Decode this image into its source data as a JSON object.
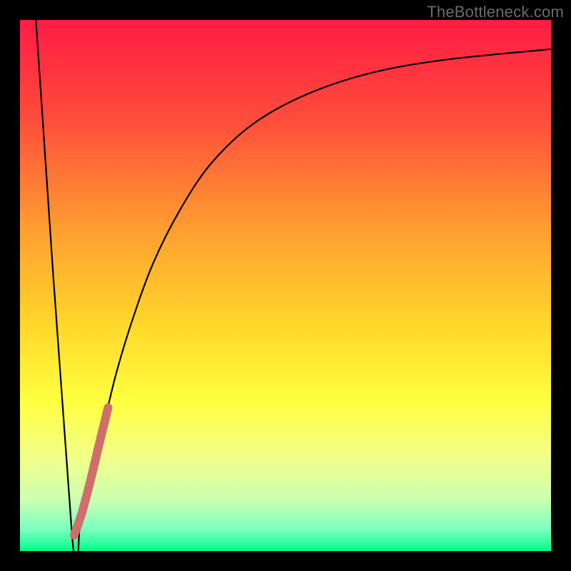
{
  "watermark": "TheBottleneck.com",
  "chart_data": {
    "type": "line",
    "title": "",
    "xlabel": "",
    "ylabel": "",
    "xlim": [
      0,
      100
    ],
    "ylim": [
      0,
      100
    ],
    "gradient_stops": [
      {
        "offset": 0,
        "color": "#ff1c44"
      },
      {
        "offset": 18,
        "color": "#ff4a3b"
      },
      {
        "offset": 40,
        "color": "#ffa030"
      },
      {
        "offset": 58,
        "color": "#ffd92a"
      },
      {
        "offset": 72,
        "color": "#ffff40"
      },
      {
        "offset": 82,
        "color": "#f2ff86"
      },
      {
        "offset": 90,
        "color": "#cfffb0"
      },
      {
        "offset": 96,
        "color": "#7affc0"
      },
      {
        "offset": 100,
        "color": "#00ff88"
      }
    ],
    "series": [
      {
        "name": "bottleneck-curve",
        "color": "#000000",
        "width": 2.2,
        "points": [
          {
            "x": 3.0,
            "y": 100.0
          },
          {
            "x": 9.8,
            "y": 3.0
          },
          {
            "x": 11.4,
            "y": 6.0
          },
          {
            "x": 13.4,
            "y": 14.0
          },
          {
            "x": 15.6,
            "y": 23.0
          },
          {
            "x": 18.0,
            "y": 33.0
          },
          {
            "x": 21.0,
            "y": 43.0
          },
          {
            "x": 25.0,
            "y": 54.0
          },
          {
            "x": 30.0,
            "y": 64.0
          },
          {
            "x": 36.0,
            "y": 73.0
          },
          {
            "x": 44.0,
            "y": 80.5
          },
          {
            "x": 54.0,
            "y": 86.0
          },
          {
            "x": 66.0,
            "y": 90.0
          },
          {
            "x": 80.0,
            "y": 92.5
          },
          {
            "x": 100.0,
            "y": 94.5
          }
        ]
      },
      {
        "name": "highlight-segment",
        "color": "#cf6e6a",
        "width": 12,
        "linecap": "round",
        "points": [
          {
            "x": 10.2,
            "y": 3.0
          },
          {
            "x": 11.6,
            "y": 7.0
          },
          {
            "x": 13.2,
            "y": 13.0
          },
          {
            "x": 15.0,
            "y": 20.5
          },
          {
            "x": 16.6,
            "y": 27.0
          }
        ]
      }
    ]
  }
}
